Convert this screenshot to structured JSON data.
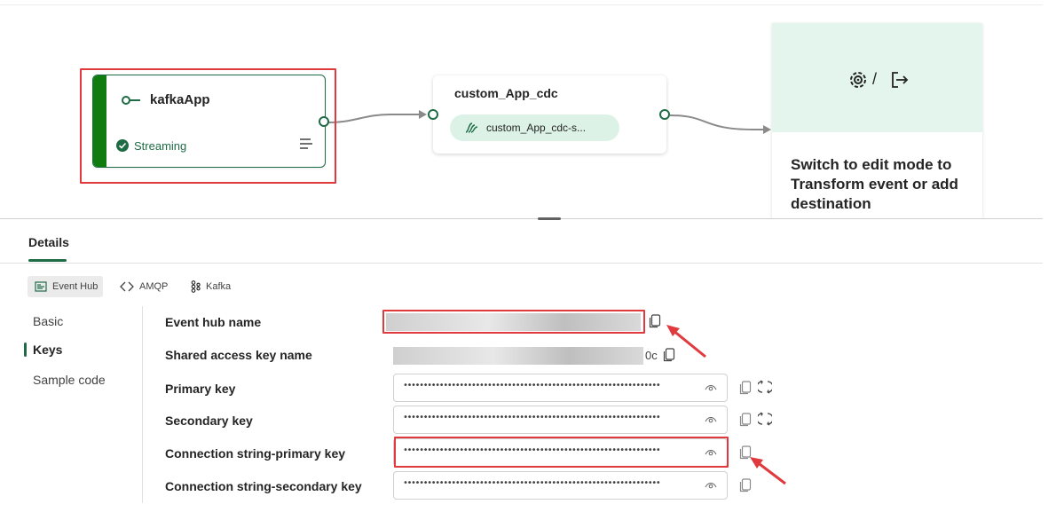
{
  "canvas": {
    "source_node": {
      "title": "kafkaApp",
      "status": "Streaming",
      "icon": "source-plug-icon"
    },
    "stream_node": {
      "title": "custom_App_cdc",
      "pill_label": "custom_App_cdc-s...",
      "icon": "eventstream-icon"
    },
    "destination_panel": {
      "slash": "/",
      "message": "Switch to edit mode to Transform event or add destination",
      "icons": [
        "transform-gear-icon",
        "exit-destination-icon"
      ]
    }
  },
  "details": {
    "tab_label": "Details",
    "protocol_tabs": [
      {
        "label": "Event Hub",
        "active": true,
        "icon": "event-hub-icon"
      },
      {
        "label": "AMQP",
        "active": false,
        "icon": "amqp-icon"
      },
      {
        "label": "Kafka",
        "active": false,
        "icon": "kafka-icon"
      }
    ],
    "nav": {
      "basic": "Basic",
      "keys": "Keys",
      "sample_code": "Sample code",
      "active": "Keys"
    },
    "fields": {
      "event_hub_name": {
        "label": "Event hub name",
        "value_tail": ""
      },
      "shared_access_key_name": {
        "label": "Shared access key name",
        "value_tail": "0c"
      },
      "primary_key": {
        "label": "Primary key",
        "value": "••••••••••••••••••••••••••••••••••••••••••••••••••••••••••••••••"
      },
      "secondary_key": {
        "label": "Secondary key",
        "value": "••••••••••••••••••••••••••••••••••••••••••••••••••••••••••••••••"
      },
      "connection_string_primary": {
        "label": "Connection string-primary key",
        "value": "••••••••••••••••••••••••••••••••••••••••••••••••••••••••••••••••"
      },
      "connection_string_secondary": {
        "label": "Connection string-secondary key",
        "value": "••••••••••••••••••••••••••••••••••••••••••••••••••••••••••••••••"
      }
    }
  },
  "colors": {
    "accent_green": "#1e6b45",
    "source_bar": "#107c10",
    "highlight_red": "#e0393e",
    "dest_panel_bg": "#e3f5ec",
    "pill_bg": "#dcf2e7"
  }
}
